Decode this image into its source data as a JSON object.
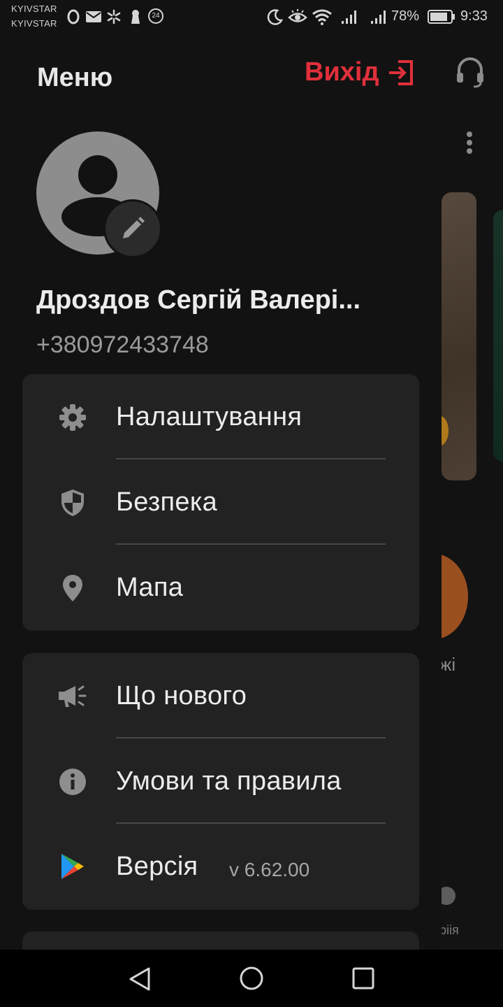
{
  "status_bar": {
    "carrier1": "KYIVSTAR",
    "carrier2": "KYIVSTAR",
    "notif_badge": "24",
    "battery": "78%",
    "time": "9:33",
    "icons": [
      "opera-icon",
      "mail-icon",
      "asterisk-icon",
      "keyhole-icon",
      "badge-24-icon",
      "moon-icon",
      "eye-icon",
      "wifi-icon",
      "signal-icon",
      "signal-icon",
      "battery-icon"
    ]
  },
  "drawer": {
    "title": "Меню",
    "logout_label": "Вихід",
    "user": {
      "name": "Дроздов Сергій Валері...",
      "phone": "+380972433748"
    },
    "groups": [
      {
        "items": [
          {
            "label": "Налаштування",
            "icon": "gear-icon"
          },
          {
            "label": "Безпека",
            "icon": "shield-icon"
          },
          {
            "label": "Мапа",
            "icon": "map-pin-icon"
          }
        ]
      },
      {
        "items": [
          {
            "label": "Що нового",
            "icon": "megaphone-icon"
          },
          {
            "label": "Умови та правила",
            "icon": "info-icon"
          },
          {
            "label": "Версія",
            "icon": "play-store-icon",
            "value": "v 6.62.00"
          }
        ]
      }
    ]
  },
  "background": {
    "text1": "жі",
    "text2": "ріія"
  },
  "colors": {
    "accent": "#e0303b",
    "drawer_bg": "#121212",
    "card_bg": "#222222"
  }
}
